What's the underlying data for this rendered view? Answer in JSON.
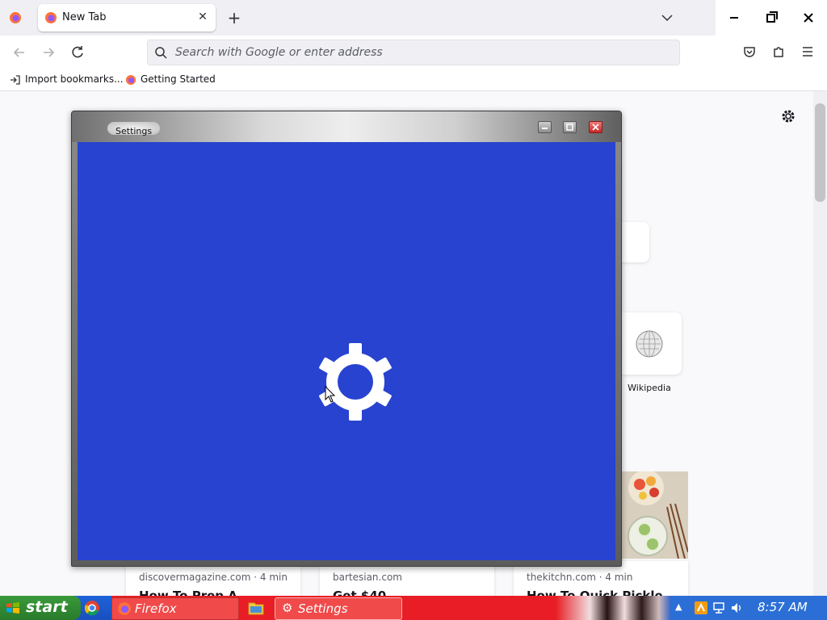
{
  "browser": {
    "tab": {
      "title": "New Tab"
    },
    "toolbar": {
      "url_placeholder": "Search with Google or enter address"
    },
    "bookmarks": [
      {
        "label": "Import bookmarks...",
        "icon": "import-icon"
      },
      {
        "label": "Getting Started",
        "icon": "firefox-icon"
      }
    ]
  },
  "newtab": {
    "shortcut": {
      "label": "Wikipedia"
    },
    "stories": [
      {
        "source": "discovermagazine.com · 4 min",
        "headline": "How To Prep A"
      },
      {
        "source": "bartesian.com",
        "headline": "Get $40"
      },
      {
        "source": "thekitchn.com · 4 min",
        "headline": "How To Quick Pickle"
      }
    ]
  },
  "settings_window": {
    "title": "Settings",
    "client_color": "#2843cf"
  },
  "taskbar": {
    "start_label": "start",
    "tasks": [
      {
        "label": "Firefox",
        "icon": "firefox-icon"
      },
      {
        "label": "Settings",
        "icon": "gear-icon"
      }
    ],
    "clock": "8:57 AM"
  }
}
